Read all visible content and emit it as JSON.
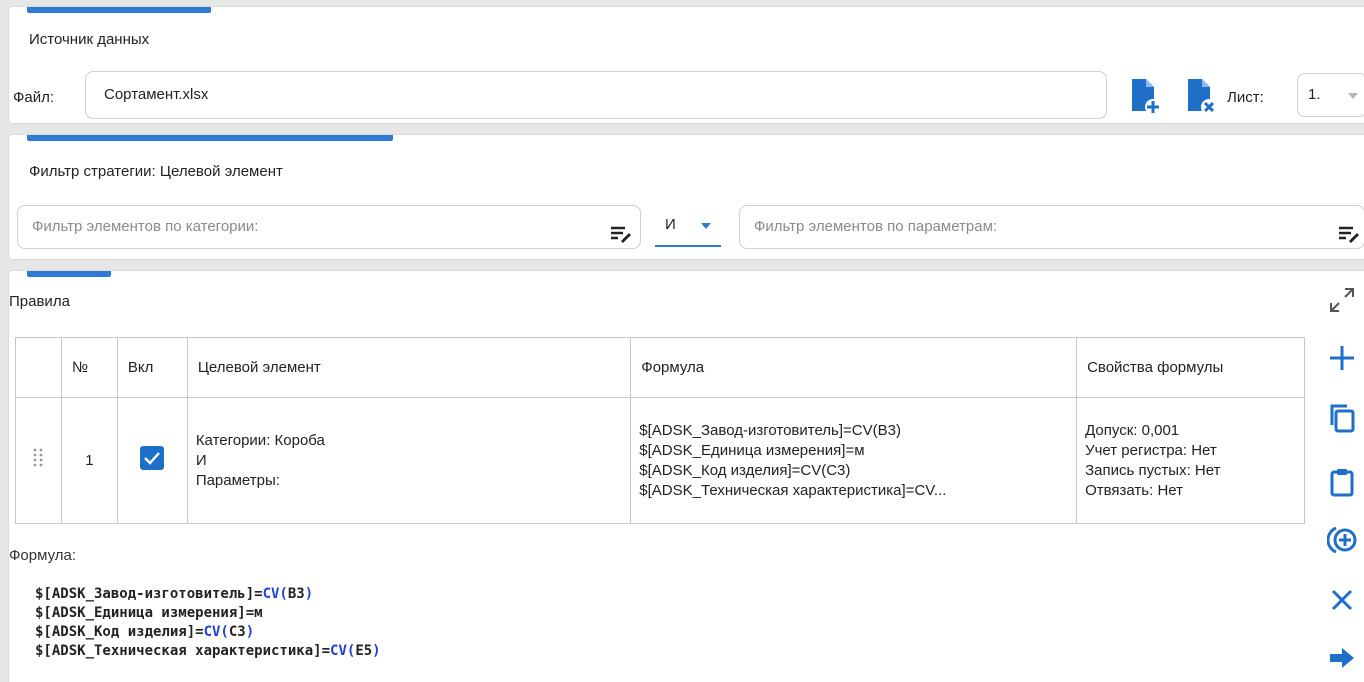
{
  "source": {
    "title": "Источник данных",
    "file_label": "Файл:",
    "file_value": "Сортамент.xlsx",
    "sheet_label": "Лист:",
    "sheet_value": "1."
  },
  "filter": {
    "title": "Фильтр стратегии: Целевой элемент",
    "category_placeholder": "Фильтр элементов по категории:",
    "logic_value": "И",
    "param_placeholder": "Фильтр элементов по параметрам:"
  },
  "rules": {
    "title": "Правила",
    "columns": [
      "№",
      "Вкл",
      "Целевой элемент",
      "Формула",
      "Свойства формулы"
    ],
    "rows": [
      {
        "no": "1",
        "target": [
          "Категории: Короба",
          "И",
          "Параметры:"
        ],
        "formula": [
          "$[ADSK_Завод-изготовитель]=CV(B3)",
          "$[ADSK_Единица измерения]=м",
          "$[ADSK_Код изделия]=CV(C3)",
          "$[ADSK_Техническая характеристика]=CV..."
        ],
        "props": [
          "Допуск: 0,001",
          "Учет регистра: Нет",
          "Запись пустых: Нет",
          "Отвязать: Нет"
        ]
      }
    ],
    "formula_label": "Формула:",
    "formula_code": [
      {
        "pre": "$[ADSK_Завод-изготовитель]=",
        "fn": "CV(",
        "arg": "B3",
        "post": ")"
      },
      {
        "pre": "$[ADSK_Единица измерения]=м",
        "fn": "",
        "arg": "",
        "post": ""
      },
      {
        "pre": "$[ADSK_Код изделия]=",
        "fn": "CV(",
        "arg": "C3",
        "post": ")"
      },
      {
        "pre": "$[ADSK_Техническая характеристика]=",
        "fn": "CV(",
        "arg": "E5",
        "post": ")"
      }
    ]
  },
  "colors": {
    "accent": "#2e7bd4",
    "icon_blue": "#1f6fc9",
    "code_fn": "#1f3fd6"
  }
}
